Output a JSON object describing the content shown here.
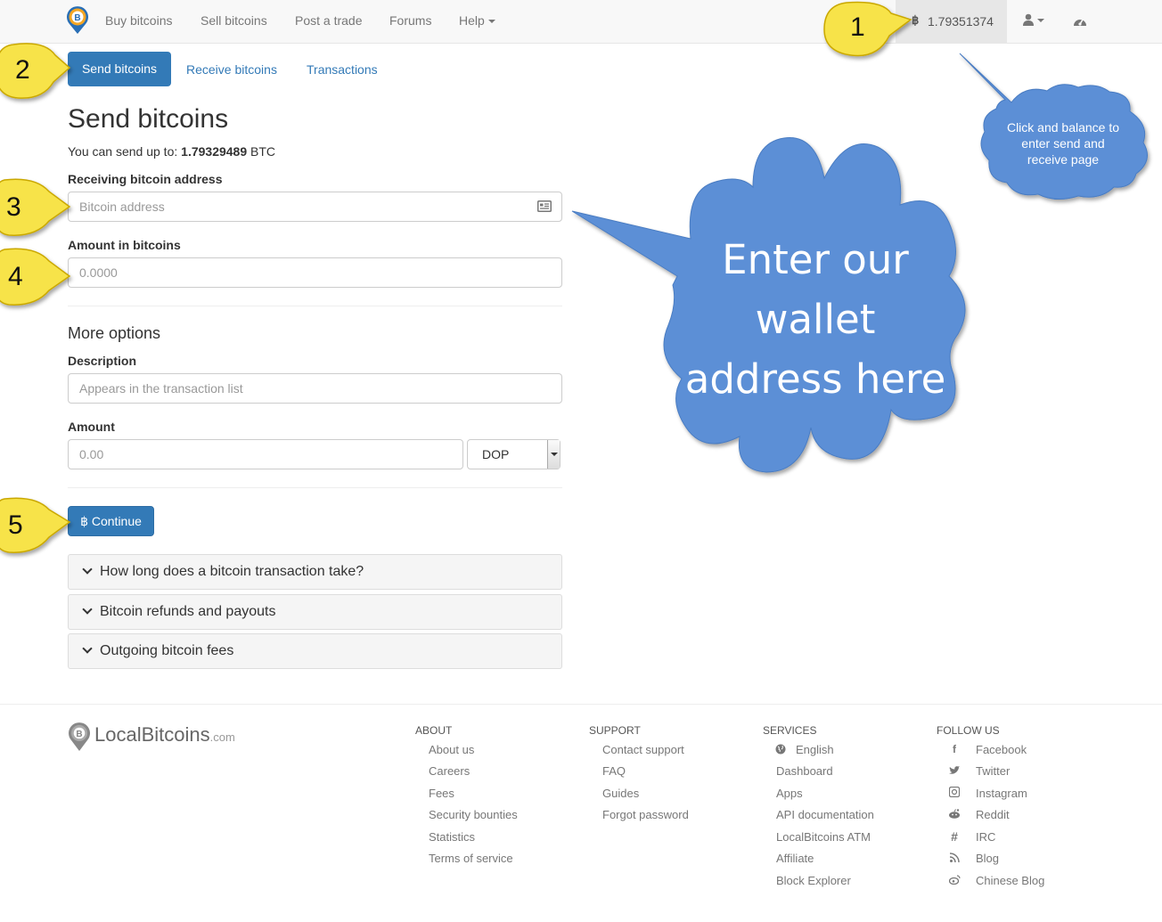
{
  "nav": {
    "links": [
      "Buy bitcoins",
      "Sell bitcoins",
      "Post a trade",
      "Forums",
      "Help"
    ],
    "balance": "1.79351374",
    "btc_symbol": "฿"
  },
  "tabs": [
    "Send bitcoins",
    "Receive bitcoins",
    "Transactions"
  ],
  "form": {
    "title": "Send bitcoins",
    "send_prefix": "You can send up to: ",
    "send_amount": "1.79329489",
    "send_unit": " BTC",
    "address_label": "Receiving bitcoin address",
    "address_placeholder": "Bitcoin address",
    "amount_label": "Amount in bitcoins",
    "amount_placeholder": "0.0000",
    "more_options": "More options",
    "description_label": "Description",
    "description_placeholder": "Appears in the transaction list",
    "amount2_label": "Amount",
    "amount2_placeholder": "0.00",
    "currency": "DOP",
    "continue_label": "฿ Continue"
  },
  "accordion": [
    "How long does a bitcoin transaction take?",
    "Bitcoin refunds and payouts",
    "Outgoing bitcoin fees"
  ],
  "footer": {
    "logo_main": "LocalBitcoins",
    "logo_suffix": ".com",
    "about": {
      "heading": "ABOUT",
      "items": [
        "About us",
        "Careers",
        "Fees",
        "Security bounties",
        "Statistics",
        "Terms of service"
      ]
    },
    "support": {
      "heading": "SUPPORT",
      "items": [
        "Contact support",
        "FAQ",
        "Guides",
        "Forgot password"
      ]
    },
    "services": {
      "heading": "SERVICES",
      "items": [
        "English",
        "Dashboard",
        "Apps",
        "API documentation",
        "LocalBitcoins ATM",
        "Affiliate",
        "Block Explorer"
      ]
    },
    "follow": {
      "heading": "FOLLOW US",
      "items": [
        "Facebook",
        "Twitter",
        "Instagram",
        "Reddit",
        "IRC",
        "Blog",
        "Chinese Blog"
      ]
    }
  },
  "annotations": {
    "numbers": [
      "1",
      "2",
      "3",
      "4",
      "5"
    ],
    "big_bubble": [
      "Enter our",
      "wallet",
      "address here"
    ],
    "small_bubble": [
      "Click and balance to",
      "enter send and",
      "receive page"
    ],
    "colors": {
      "callout_yellow": "#f7e34a",
      "bubble_blue": "#5b8fd6",
      "link_blue": "#337ab7"
    }
  }
}
